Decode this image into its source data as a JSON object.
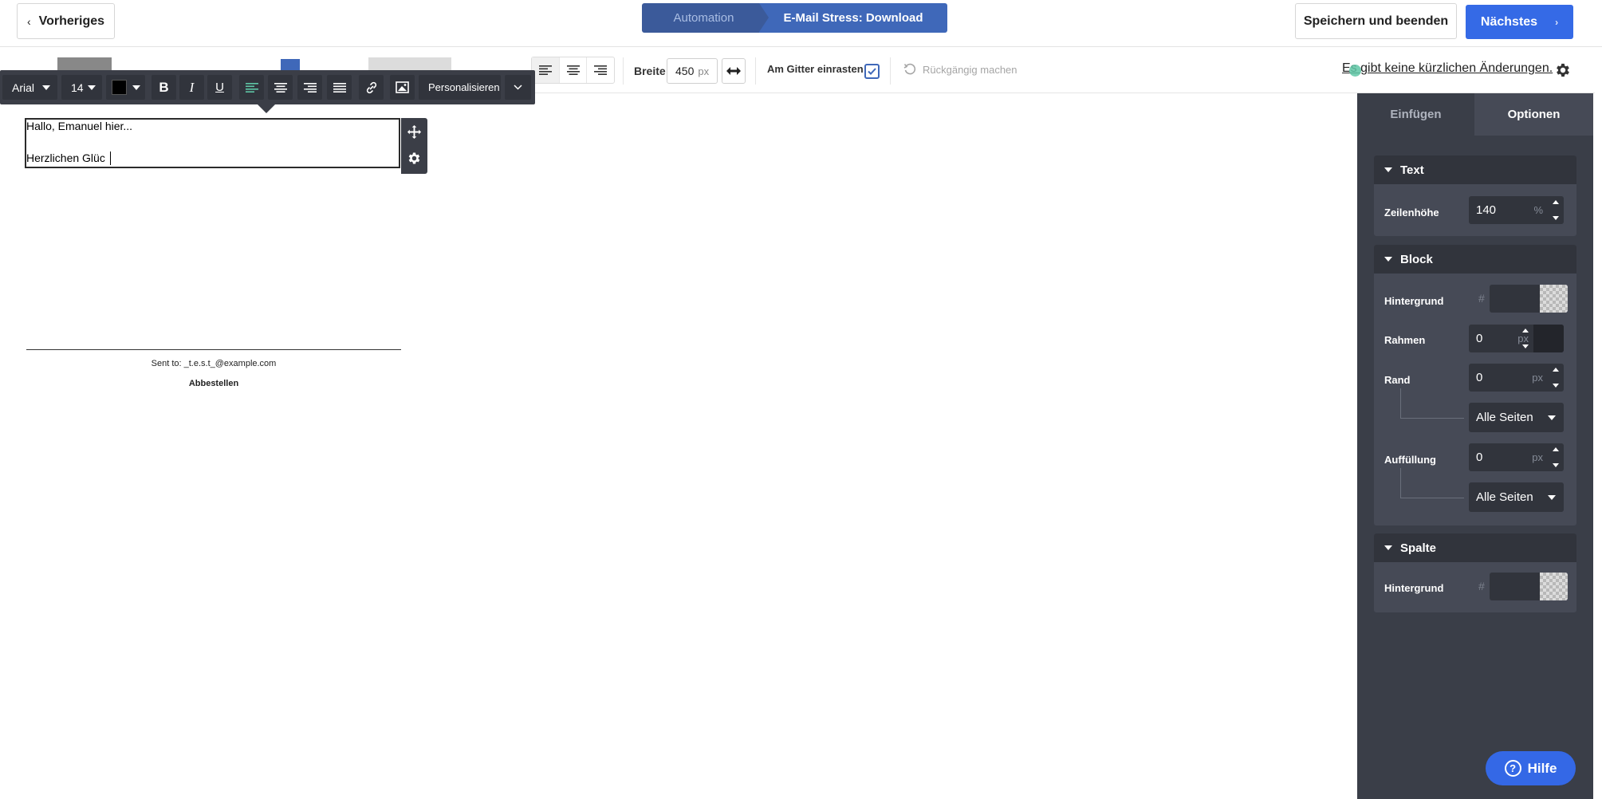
{
  "header": {
    "prev_label": "Vorheriges",
    "breadcrumb": [
      "Automation",
      "E-Mail Stress: Download"
    ],
    "save_exit_label": "Speichern und beenden",
    "next_label": "Nächstes"
  },
  "toolbar": {
    "width_label": "Breite",
    "width_value": "450",
    "width_unit": "px",
    "grid_snap_label": "Am Gitter einrasten",
    "grid_snap_checked": true,
    "undo_label": "Rückgängig machen",
    "no_changes_label": "Es gibt keine kürzlichen Änderungen."
  },
  "rich_toolbar": {
    "font": "Arial",
    "size": "14",
    "text_color": "#000000",
    "bold": "B",
    "italic": "I",
    "underline": "U",
    "personalize_label": "Personalisieren"
  },
  "canvas": {
    "line1": "Hallo, Emanuel hier...",
    "line2": "Herzlichen Glüc",
    "sent_to": "Sent to: _t.e.s.t_@example.com",
    "unsubscribe": "Abbestellen"
  },
  "panel": {
    "tabs": [
      "Einfügen",
      "Optionen"
    ],
    "text_section": {
      "title": "Text",
      "line_height_label": "Zeilenhöhe",
      "line_height_value": "140",
      "line_height_unit": "%"
    },
    "block_section": {
      "title": "Block",
      "background_label": "Hintergrund",
      "border_label": "Rahmen",
      "border_value": "0",
      "border_unit": "px",
      "margin_label": "Rand",
      "margin_value": "0",
      "margin_unit": "px",
      "margin_sides": "Alle Seiten",
      "padding_label": "Auffüllung",
      "padding_value": "0",
      "padding_unit": "px",
      "padding_sides": "Alle Seiten"
    },
    "column_section": {
      "title": "Spalte",
      "background_label": "Hintergrund"
    },
    "hash": "#"
  },
  "help_label": "Hilfe",
  "colors": {
    "primary": "#356ae6",
    "panel": "#3a3e48",
    "toolbar_dark": "#3b3e47"
  }
}
